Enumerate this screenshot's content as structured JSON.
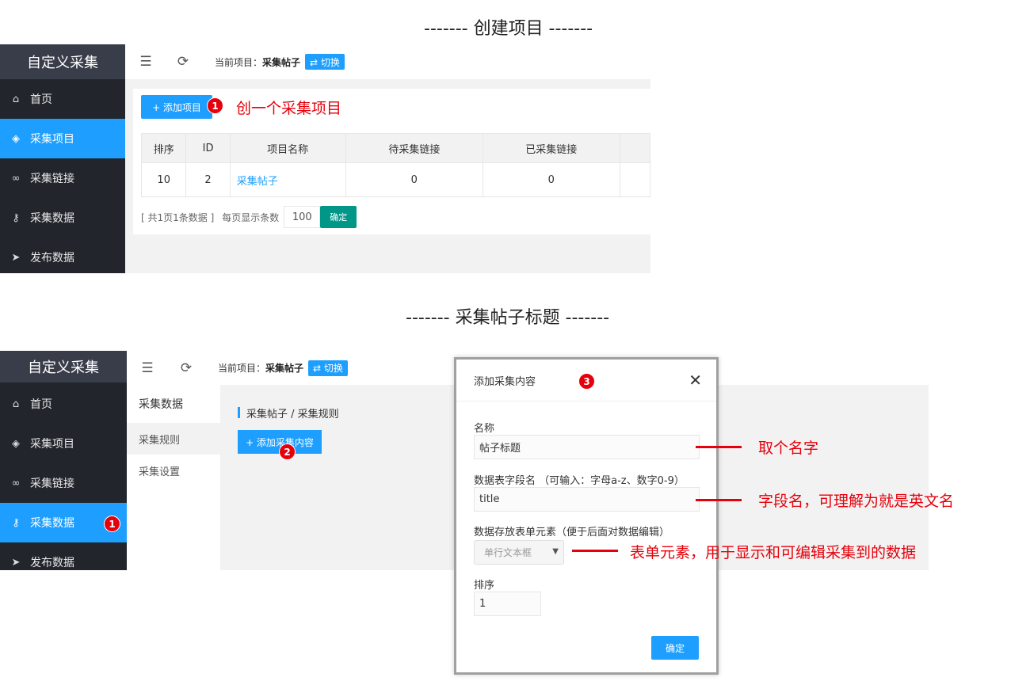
{
  "titles": {
    "section1": "------- 创建项目 -------",
    "section2": "------- 采集帖子标题 -------"
  },
  "app": {
    "brand": "自定义采集",
    "sidebar": [
      {
        "label": "首页",
        "icon": "home-icon"
      },
      {
        "label": "采集项目",
        "icon": "layers-icon"
      },
      {
        "label": "采集链接",
        "icon": "link-icon"
      },
      {
        "label": "采集数据",
        "icon": "key-icon"
      },
      {
        "label": "发布数据",
        "icon": "paper-plane-icon"
      }
    ],
    "current_project_label": "当前项目：",
    "current_project": "采集帖子",
    "switch_label": "⇄ 切换"
  },
  "panel1": {
    "add_project_label": "+ 添加项目",
    "table": {
      "headers": [
        "排序",
        "ID",
        "项目名称",
        "待采集链接",
        "已采集链接"
      ],
      "rows": [
        {
          "order": "10",
          "id": "2",
          "name": "采集帖子",
          "pending": "0",
          "collected": "0"
        }
      ]
    },
    "pager": {
      "summary": "[ 共1页1条数据 ]",
      "per_page_label": "每页显示条数",
      "per_page_value": "100",
      "confirm": "确定"
    }
  },
  "panel2": {
    "subnav_title": "采集数据",
    "subnav_items": [
      "采集规则",
      "采集设置"
    ],
    "breadcrumb": "采集帖子 / 采集规则",
    "add_content_label": "+ 添加采集内容"
  },
  "modal": {
    "title": "添加采集内容",
    "name_label": "名称",
    "name_value": "帖子标题",
    "field_label": "数据表字段名  （可输入：字母a-z、数字0-9）",
    "field_value": "title",
    "element_label": "数据存放表单元素（便于后面对数据编辑）",
    "element_value": "单行文本框",
    "order_label": "排序",
    "order_value": "1",
    "confirm": "确定"
  },
  "annotations": {
    "badge1": "1",
    "badge2": "2",
    "badge3": "3",
    "create_project": "创一个采集项目",
    "name_hint": "取个名字",
    "field_hint": "字段名，可理解为就是英文名",
    "element_hint": "表单元素，用于显示和可编辑采集到的数据"
  },
  "colors": {
    "accent": "#1e9fff",
    "sidebar_bg": "#22252c",
    "brand_bg": "#393d49",
    "confirm_green": "#009688",
    "annotation_red": "#e6000b"
  }
}
